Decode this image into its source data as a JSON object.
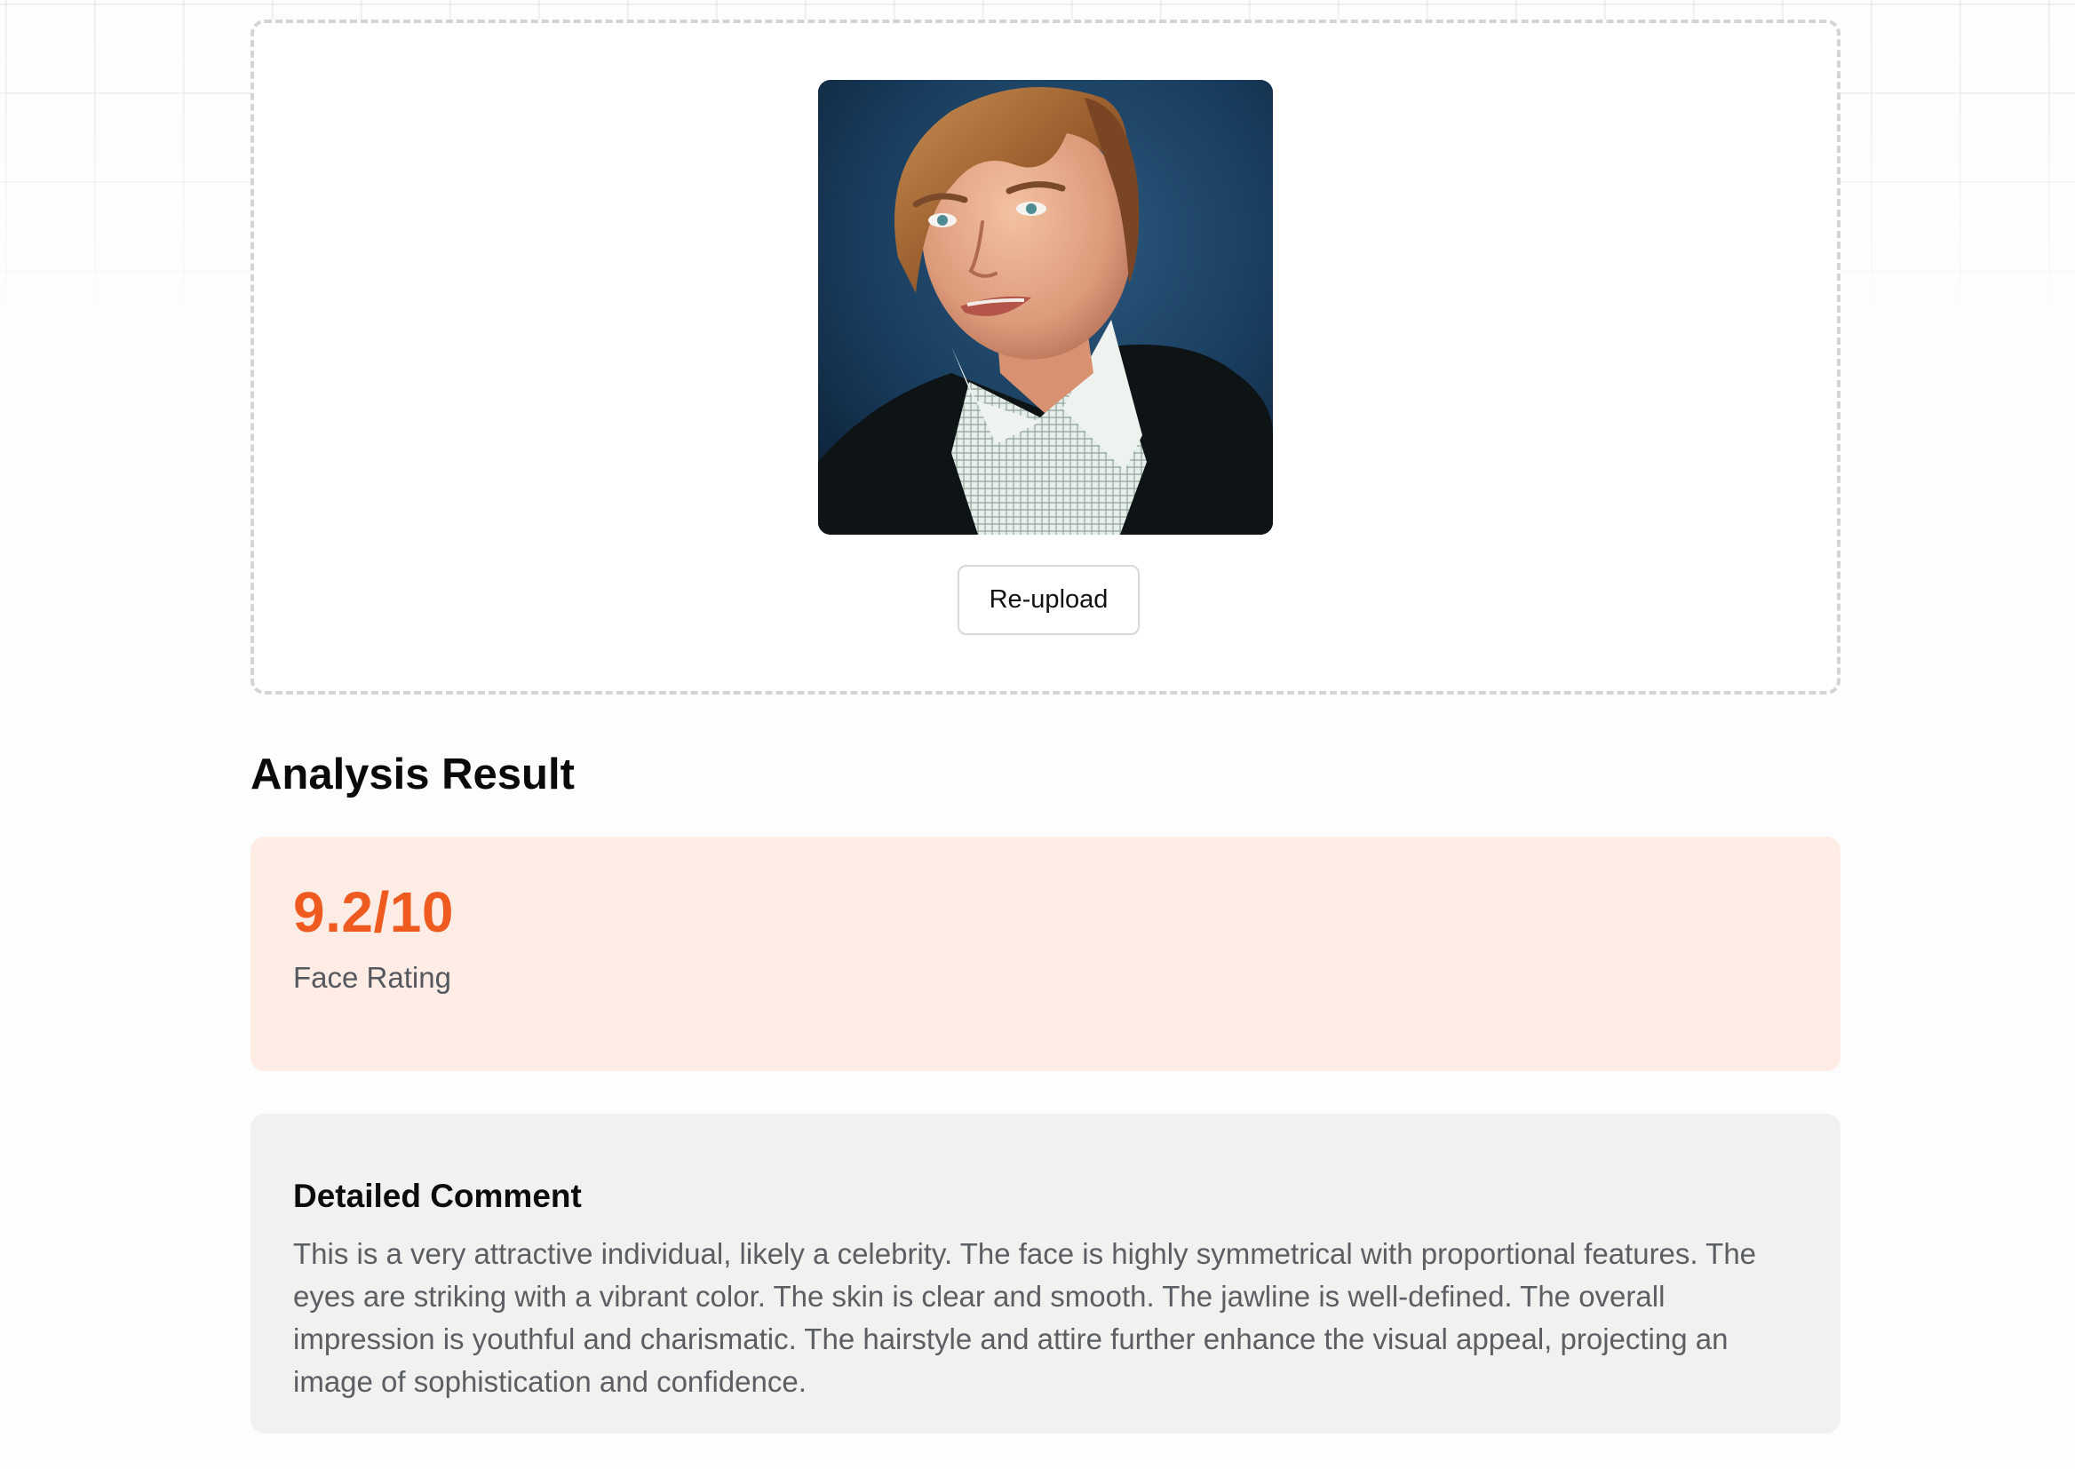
{
  "upload": {
    "photo_alt": "Uploaded face photo",
    "reupload_label": "Re-upload"
  },
  "results": {
    "title": "Analysis Result",
    "score": "9.2/10",
    "score_label": "Face Rating",
    "comment_title": "Detailed Comment",
    "comment_body": "This is a very attractive individual, likely a celebrity. The face is highly symmetrical with proportional features. The eyes are striking with a vibrant color. The skin is clear and smooth. The jawline is well-defined. The overall impression is youthful and charismatic. The hairstyle and attire further enhance the visual appeal, projecting an image of sophistication and confidence."
  },
  "colors": {
    "accent": "#ef5a1f",
    "score_card_bg": "#ffece5",
    "comment_card_bg": "#f1f1f0",
    "dashed_border": "#d4d4d4"
  }
}
